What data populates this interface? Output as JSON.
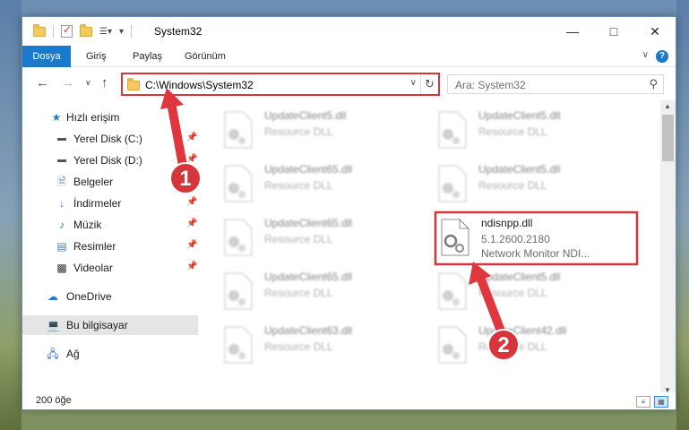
{
  "window": {
    "title": "System32",
    "qa_more": "▾"
  },
  "ribbon": {
    "tabs": [
      "Dosya",
      "Giriş",
      "Paylaş",
      "Görünüm"
    ]
  },
  "nav": {
    "address": "C:\\Windows\\System32",
    "search_placeholder": "Ara: System32"
  },
  "sidebar": {
    "items": [
      {
        "label": "Hızlı erişim",
        "icon": "star-icon"
      },
      {
        "label": "Yerel Disk (C:)",
        "icon": "drive-icon",
        "pinned": true
      },
      {
        "label": "Yerel Disk (D:)",
        "icon": "drive-icon",
        "pinned": true
      },
      {
        "label": "Belgeler",
        "icon": "documents-icon",
        "pinned": true
      },
      {
        "label": "İndirmeler",
        "icon": "download-icon",
        "pinned": true
      },
      {
        "label": "Müzik",
        "icon": "music-icon",
        "pinned": true
      },
      {
        "label": "Resimler",
        "icon": "pictures-icon",
        "pinned": true
      },
      {
        "label": "Videolar",
        "icon": "videos-icon",
        "pinned": true
      },
      {
        "label": "OneDrive",
        "icon": "cloud-icon"
      },
      {
        "label": "Bu bilgisayar",
        "icon": "computer-icon",
        "selected": true
      },
      {
        "label": "Ağ",
        "icon": "network-icon"
      }
    ]
  },
  "files": [
    {
      "name": "UpdateClient5.dll",
      "sub1": "Resource DLL",
      "sub2": ""
    },
    {
      "name": "UpdateClient5.dll",
      "sub1": "Resource DLL",
      "sub2": ""
    },
    {
      "name": "UpdateClient65.dll",
      "sub1": "Resource DLL",
      "sub2": ""
    },
    {
      "name": "UpdateClient5.dll",
      "sub1": "Resource DLL",
      "sub2": ""
    },
    {
      "name": "UpdateClient65.dll",
      "sub1": "Resource DLL",
      "sub2": ""
    },
    {
      "name": "ndisnpp.dll",
      "sub1": "5.1.2600.2180",
      "sub2": "Network Monitor NDI..."
    },
    {
      "name": "UpdateClient65.dll",
      "sub1": "Resource DLL",
      "sub2": ""
    },
    {
      "name": "UpdateClient5.dll",
      "sub1": "Resource DLL",
      "sub2": ""
    },
    {
      "name": "UpdateClient63.dll",
      "sub1": "Resource DLL",
      "sub2": ""
    },
    {
      "name": "UpdateClient42.dll",
      "sub1": "Resource DLL",
      "sub2": ""
    }
  ],
  "status": {
    "count": "200 öğe"
  },
  "annotations": {
    "badge1": "1",
    "badge2": "2",
    "color": "#d6353b"
  }
}
